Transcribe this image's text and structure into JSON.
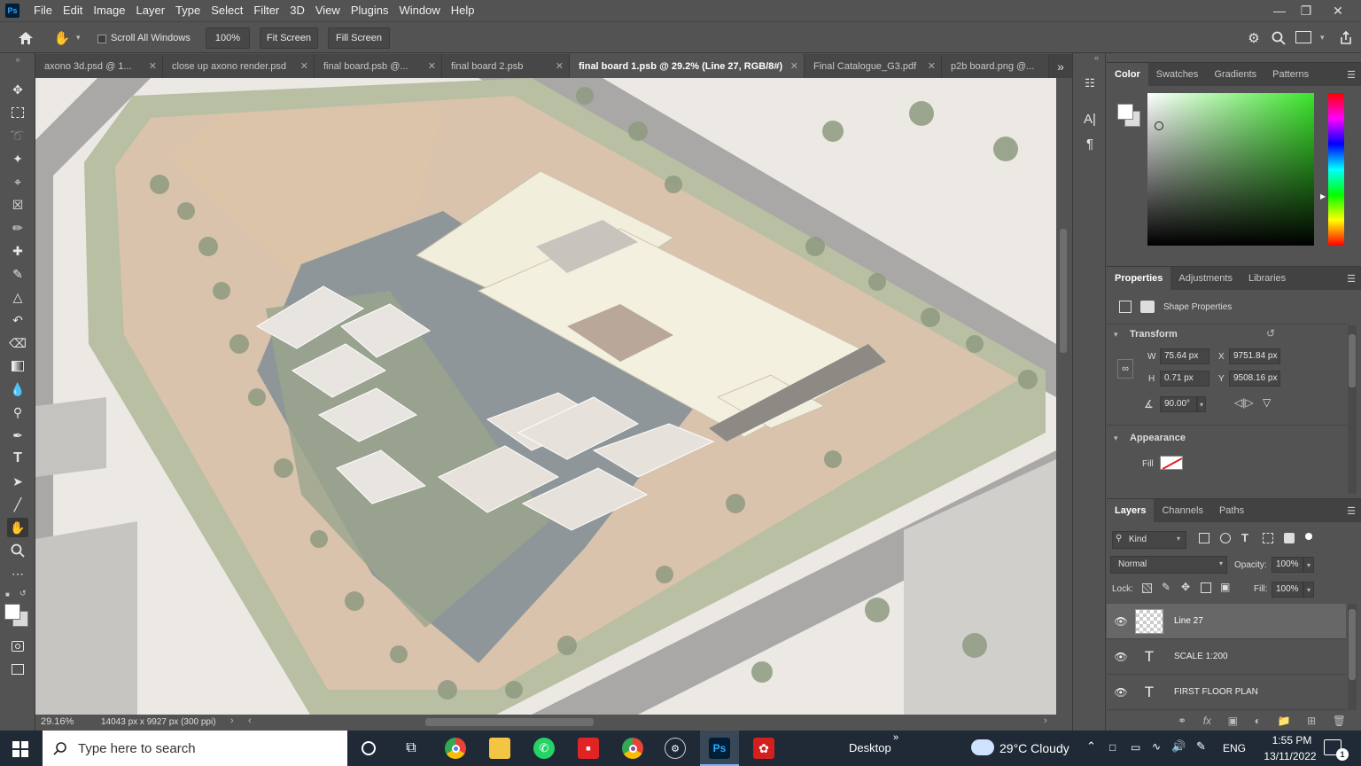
{
  "app": {
    "logo": "Ps",
    "menu": [
      "File",
      "Edit",
      "Image",
      "Layer",
      "Type",
      "Select",
      "Filter",
      "3D",
      "View",
      "Plugins",
      "Window",
      "Help"
    ]
  },
  "options_bar": {
    "scroll_all_windows": "Scroll All Windows",
    "zoom_btn": "100%",
    "fit_screen": "Fit Screen",
    "fill_screen": "Fill Screen"
  },
  "tabs": [
    {
      "label": "axono 3d.psd @ 1...",
      "active": false
    },
    {
      "label": "close up axono render.psd",
      "active": false
    },
    {
      "label": "final board.psb @...",
      "active": false
    },
    {
      "label": "final board 2.psb",
      "active": false
    },
    {
      "label": "final board 1.psb @ 29.2% (Line 27, RGB/8#)",
      "active": true
    },
    {
      "label": "Final Catalogue_G3.pdf",
      "active": false
    },
    {
      "label": "p2b board.png @...",
      "active": false
    }
  ],
  "status": {
    "zoom": "29.16%",
    "dimensions": "14043 px x 9927 px (300 ppi)"
  },
  "color_panel": {
    "tabs": [
      "Color",
      "Swatches",
      "Gradients",
      "Patterns"
    ]
  },
  "properties_panel": {
    "tabs": [
      "Properties",
      "Adjustments",
      "Libraries"
    ],
    "kind": "Shape Properties",
    "transform_title": "Transform",
    "w_label": "W",
    "w_value": "75.64 px",
    "h_label": "H",
    "h_value": "0.71 px",
    "x_label": "X",
    "x_value": "9751.84 px",
    "y_label": "Y",
    "y_value": "9508.16 px",
    "angle_value": "90.00°",
    "appearance_title": "Appearance",
    "fill_label": "Fill"
  },
  "layers_panel": {
    "tabs": [
      "Layers",
      "Channels",
      "Paths"
    ],
    "filter_kind": "Kind",
    "blend_mode": "Normal",
    "opacity_label": "Opacity:",
    "opacity_value": "100%",
    "lock_label": "Lock:",
    "fill_label": "Fill:",
    "fill_value": "100%",
    "layers": [
      {
        "name": "Line 27",
        "type": "shape",
        "selected": true
      },
      {
        "name": "SCALE 1:200",
        "type": "text",
        "selected": false
      },
      {
        "name": "FIRST FLOOR PLAN",
        "type": "text",
        "selected": false
      }
    ]
  },
  "taskbar": {
    "search_placeholder": "Type here to search",
    "desktop_label": "Desktop",
    "weather": "29°C  Cloudy",
    "lang": "ENG",
    "time": "1:55 PM",
    "date": "13/11/2022",
    "notif_count": "1"
  }
}
